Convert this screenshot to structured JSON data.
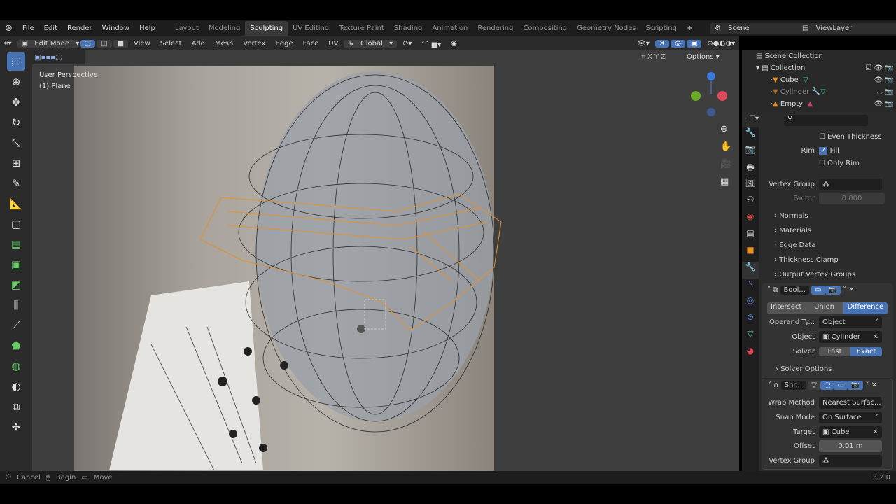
{
  "menu": {
    "items": [
      "File",
      "Edit",
      "Render",
      "Window",
      "Help"
    ]
  },
  "workspaces": [
    "Layout",
    "Modeling",
    "Sculpting",
    "UV Editing",
    "Texture Paint",
    "Shading",
    "Animation",
    "Rendering",
    "Compositing",
    "Geometry Nodes",
    "Scripting"
  ],
  "active_workspace": "Sculpting",
  "scene": "Scene",
  "view_layer": "ViewLayer",
  "header": {
    "mode": "Edit Mode",
    "menus": [
      "View",
      "Select",
      "Add",
      "Mesh",
      "Vertex",
      "Edge",
      "Face",
      "UV"
    ],
    "orientation": "Global",
    "options": "Options",
    "axes": [
      "X",
      "Y",
      "Z"
    ]
  },
  "viewport": {
    "view_name": "User Perspective",
    "object_name": "(1) Plane"
  },
  "outliner": {
    "root": "Scene Collection",
    "collection": "Collection",
    "objects": [
      "Cube",
      "Cylinder",
      "Empty"
    ]
  },
  "props": {
    "even_thickness": "Even Thickness",
    "rim_label": "Rim",
    "fill": "Fill",
    "only_rim": "Only Rim",
    "vertex_group": "Vertex Group",
    "factor_label": "Factor",
    "factor": "0.000",
    "subpanels": [
      "Normals",
      "Materials",
      "Edge Data",
      "Thickness Clamp",
      "Output Vertex Groups"
    ],
    "boolean": {
      "name": "Bool...",
      "ops": [
        "Intersect",
        "Union",
        "Difference"
      ],
      "active_op": "Difference",
      "operand_label": "Operand Ty...",
      "operand": "Object",
      "object_label": "Object",
      "object": "Cylinder",
      "solver_label": "Solver",
      "solvers": [
        "Fast",
        "Exact"
      ],
      "active_solver": "Exact",
      "solver_options": "Solver Options"
    },
    "shrinkwrap": {
      "name": "Shr...",
      "wrap_label": "Wrap Method",
      "wrap": "Nearest Surfac...",
      "snap_label": "Snap Mode",
      "snap": "On Surface",
      "target_label": "Target",
      "target": "Cube",
      "offset_label": "Offset",
      "offset": "0.01 m",
      "vg_label": "Vertex Group"
    }
  },
  "status": {
    "cancel": "Cancel",
    "begin": "Begin",
    "move": "Move",
    "version": "3.2.0"
  },
  "colors": {
    "accent": "#4772b3",
    "selected": "#e8902a"
  }
}
